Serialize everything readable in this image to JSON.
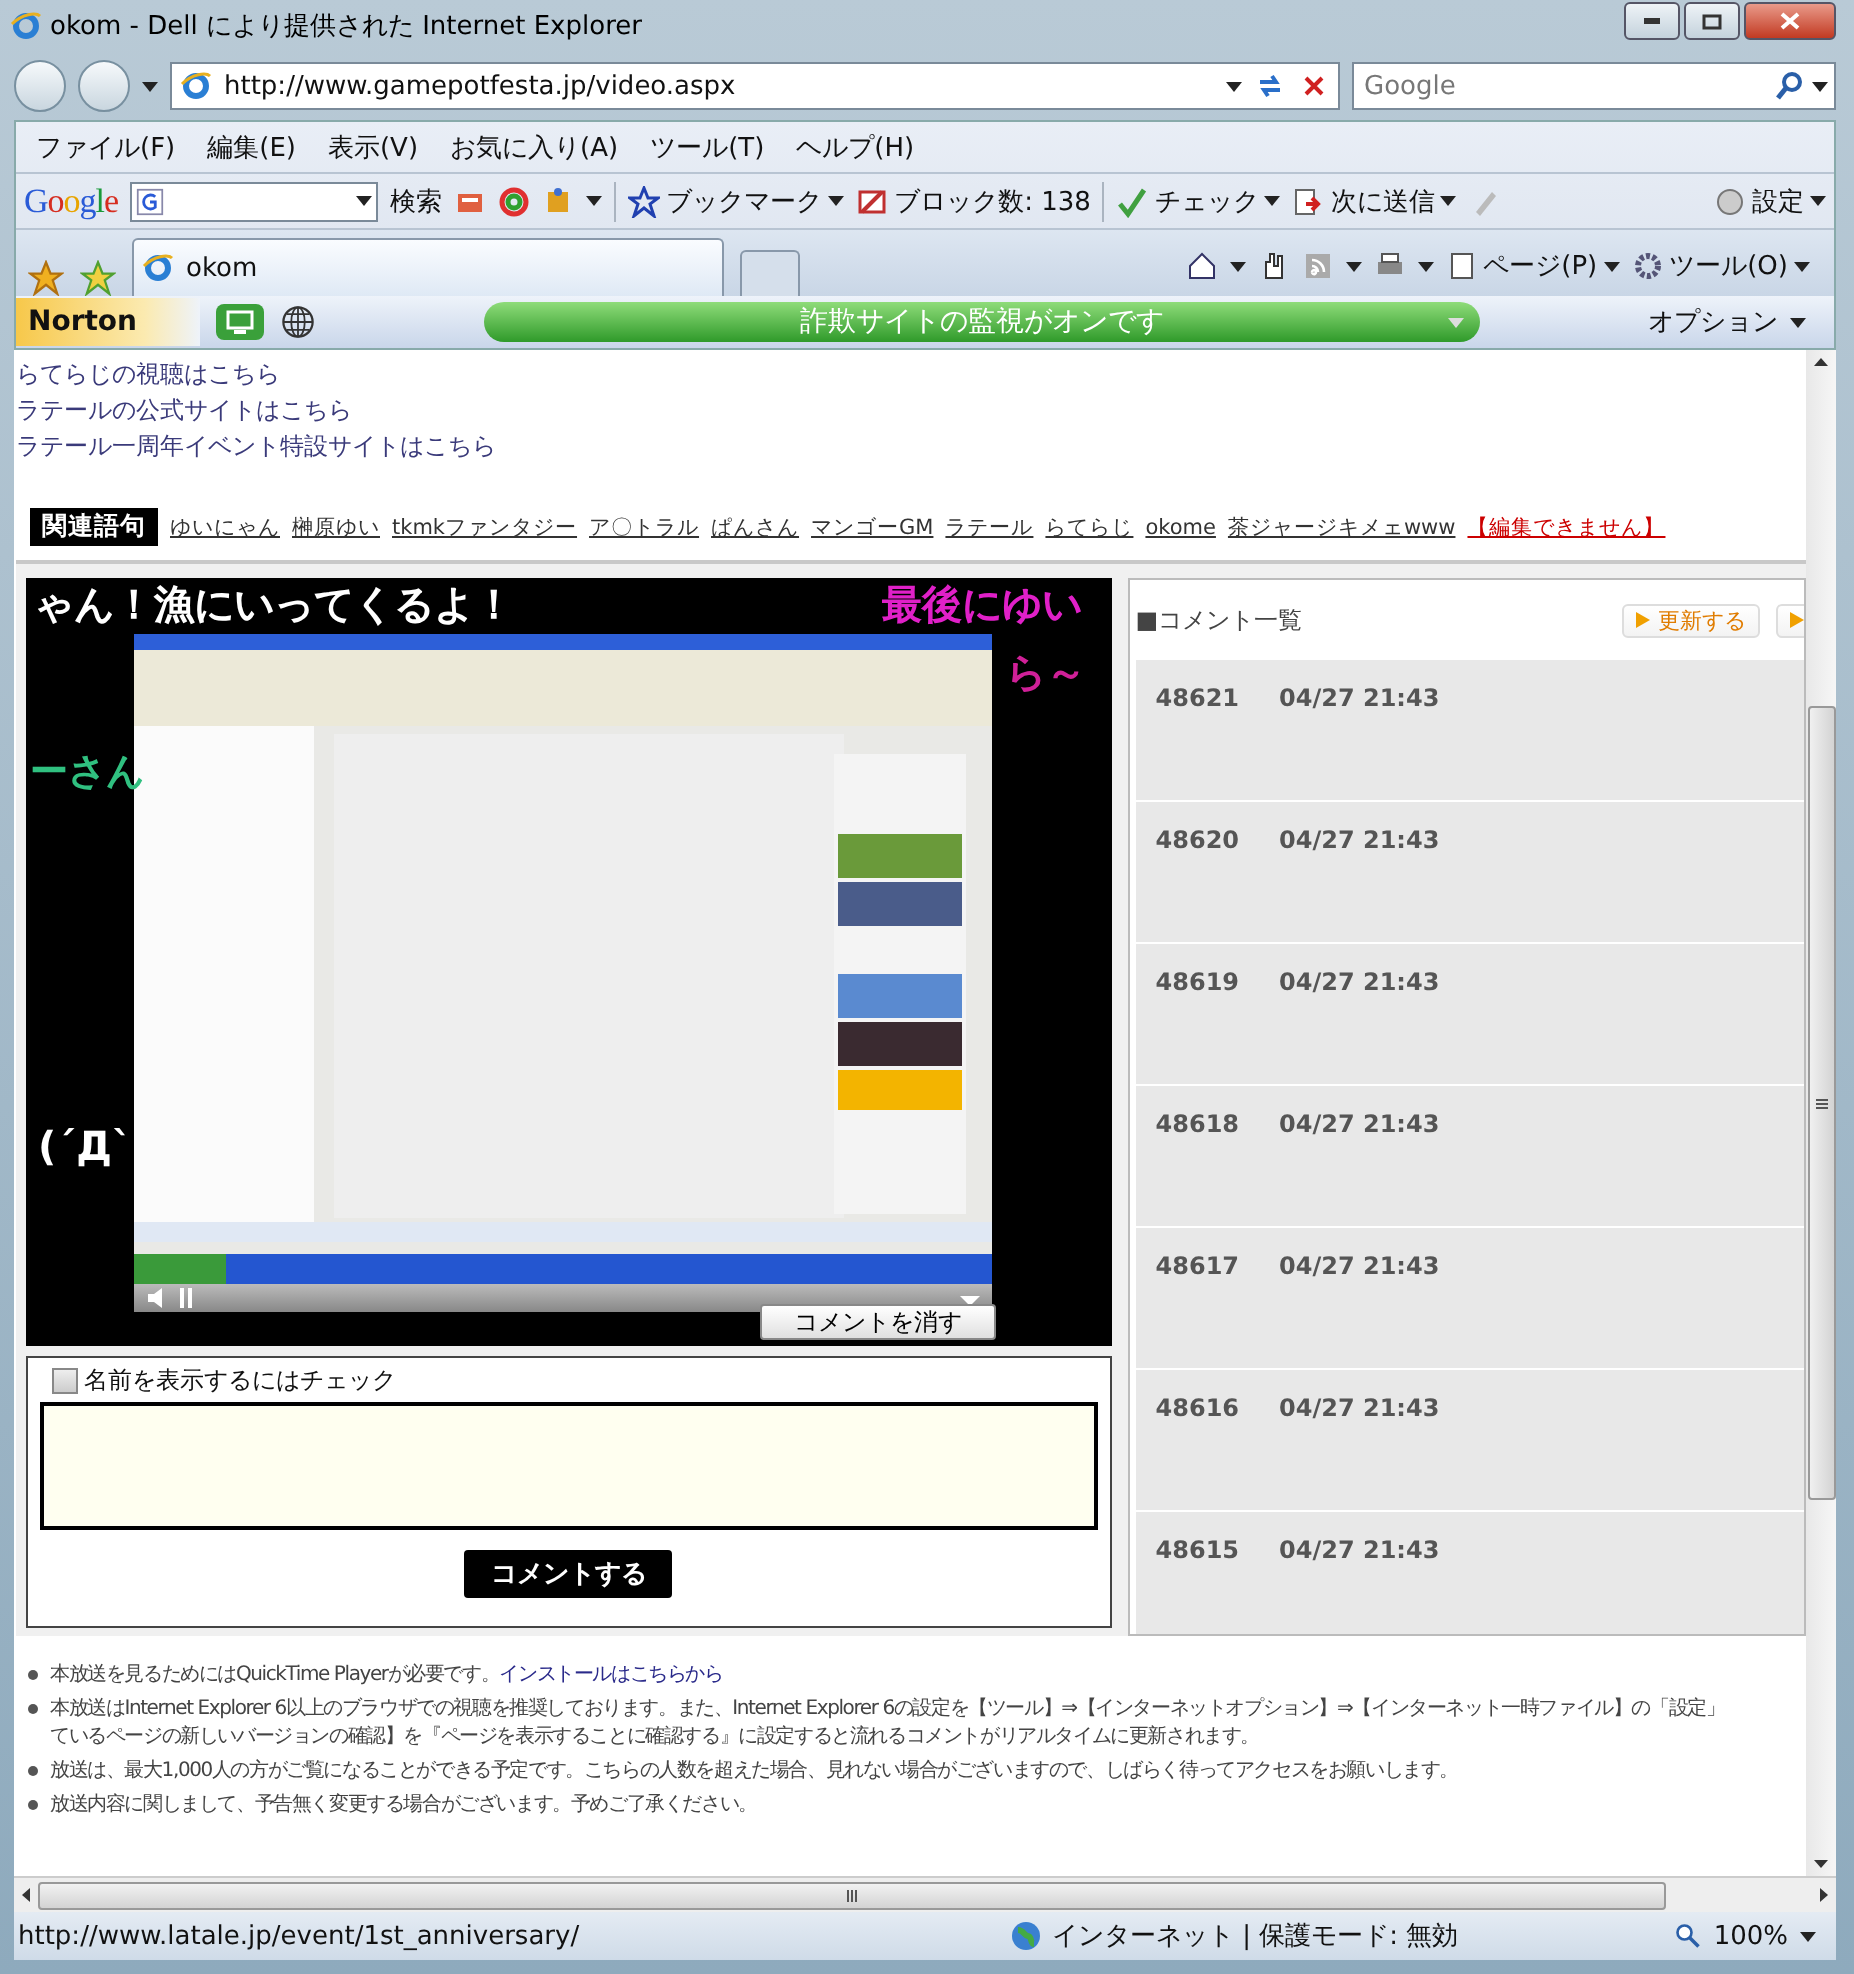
{
  "window": {
    "title": "okom - Dell により提供された Internet Explorer"
  },
  "address_bar": {
    "url": "http://www.gamepotfesta.jp/video.aspx"
  },
  "search_box": {
    "placeholder": "Google"
  },
  "menu": [
    "ファイル(F)",
    "編集(E)",
    "表示(V)",
    "お気に入り(A)",
    "ツール(T)",
    "ヘルプ(H)"
  ],
  "google_toolbar": {
    "logo": "Google",
    "search_button": "検索",
    "bookmark": "ブックマーク",
    "block_count": "ブロック数: 138",
    "check": "チェック",
    "send": "次に送信",
    "settings": "設定"
  },
  "tabs": [
    {
      "label": "okom",
      "selected": true
    }
  ],
  "command_bar": {
    "page": "ページ(P)",
    "tools": "ツール(O)"
  },
  "norton": {
    "logo": "Norton",
    "status": "詐欺サイトの監視がオンです",
    "options": "オプション"
  },
  "links": [
    "らてらじの視聴はこちら",
    "ラテールの公式サイトはこちら",
    "ラテール一周年イベント特設サイトはこちら"
  ],
  "related": {
    "label": "関連語句",
    "terms": [
      "ゆいにゃん",
      "榊原ゆい",
      "tkmkファンタジー",
      "ア〇トラル",
      "ぱんさん",
      "マンゴーGM",
      "ラテール",
      "らてらじ",
      "okome",
      "茶ジャージキメェwww"
    ],
    "edit_note": "【編集できません】"
  },
  "video": {
    "overlay_comments": [
      {
        "text": "ゃん！漁にいってくるよ！",
        "color": "#ffffff"
      },
      {
        "text": "最後にゆい",
        "color": "#e020c8"
      },
      {
        "text": "ら～",
        "color": "#d02098"
      },
      {
        "text": "ーさん",
        "color": "#30c080"
      },
      {
        "text": "(´Д`",
        "color": "#ffffff"
      }
    ],
    "hide_button": "コメントを消す"
  },
  "comment_form": {
    "show_name": {
      "label": "名前を表示するにはチェック",
      "checked": false
    },
    "submit": "コメントする"
  },
  "comment_list": {
    "title": "■コメント一覧",
    "refresh": "更新する",
    "comments": [
      {
        "number": "48621",
        "time": "04/27 21:43"
      },
      {
        "number": "48620",
        "time": "04/27 21:43"
      },
      {
        "number": "48619",
        "time": "04/27 21:43"
      },
      {
        "number": "48618",
        "time": "04/27 21:43"
      },
      {
        "number": "48617",
        "time": "04/27 21:43"
      },
      {
        "number": "48616",
        "time": "04/27 21:43"
      },
      {
        "number": "48615",
        "time": "04/27 21:43"
      }
    ]
  },
  "notes": [
    {
      "lines": [
        "本放送を見るためにはQuickTime Playerが必要です。"
      ],
      "link": "インストールはこちらから"
    },
    {
      "lines": [
        "本放送はInternet Explorer 6以上のブラウザでの視聴を推奨しております。また、Internet Explorer 6の設定を【ツール】⇒【インターネットオプション】⇒【インターネット一時ファイル】の「設定」",
        "ているページの新しいバージョンの確認】を『ページを表示することに確認する』に設定すると流れるコメントがリアルタイムに更新されます。"
      ]
    },
    {
      "lines": [
        "放送は、最大1,000人の方がご覧になることができる予定です。こちらの人数を超えた場合、見れない場合がございますので、しばらく待ってアクセスをお願いします。"
      ]
    },
    {
      "lines": [
        "放送内容に関しまして、予告無く変更する場合がございます。予めご了承ください。"
      ]
    }
  ],
  "status_bar": {
    "url": "http://www.latale.jp/event/1st_anniversary/",
    "zone": "インターネット | 保護モード: 無効",
    "zoom": "100%"
  }
}
